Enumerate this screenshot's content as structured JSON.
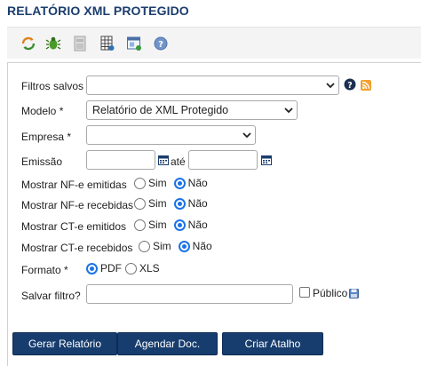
{
  "page": {
    "title": "RELATÓRIO XML PROTEGIDO"
  },
  "toolbar": {
    "icons": [
      "refresh-icon",
      "bug-icon",
      "document-icon",
      "grid-report-icon",
      "window-icon",
      "help-icon"
    ]
  },
  "form": {
    "filtros_salvos": {
      "label": "Filtros salvos",
      "value": ""
    },
    "modelo": {
      "label": "Modelo *",
      "value": "Relatório de XML Protegido"
    },
    "empresa": {
      "label": "Empresa *",
      "value": ""
    },
    "emissao": {
      "label": "Emissão",
      "start": "",
      "sep": "até",
      "end": ""
    },
    "radio_groups": [
      {
        "label": "Mostrar NF-e emitidas",
        "options": [
          "Sim",
          "Não"
        ],
        "selected": "Não"
      },
      {
        "label": "Mostrar NF-e recebidas",
        "options": [
          "Sim",
          "Não"
        ],
        "selected": "Não"
      },
      {
        "label": "Mostrar CT-e emitidos",
        "options": [
          "Sim",
          "Não"
        ],
        "selected": "Não"
      },
      {
        "label": "Mostrar CT-e recebidos",
        "options": [
          "Sim",
          "Não"
        ],
        "selected": "Não"
      }
    ],
    "formato": {
      "label": "Formato *",
      "options": [
        "PDF",
        "XLS"
      ],
      "selected": "PDF"
    },
    "salvar_filtro": {
      "label": "Salvar filtro?",
      "value": "",
      "publico_label": "Público",
      "publico_checked": false
    }
  },
  "buttons": {
    "gerar": "Gerar Relatório",
    "agendar": "Agendar Doc.",
    "atalho": "Criar Atalho"
  },
  "colors": {
    "title": "#1b3d6e",
    "button_bg": "#173d6e",
    "radio_on": "#1a73e8"
  }
}
